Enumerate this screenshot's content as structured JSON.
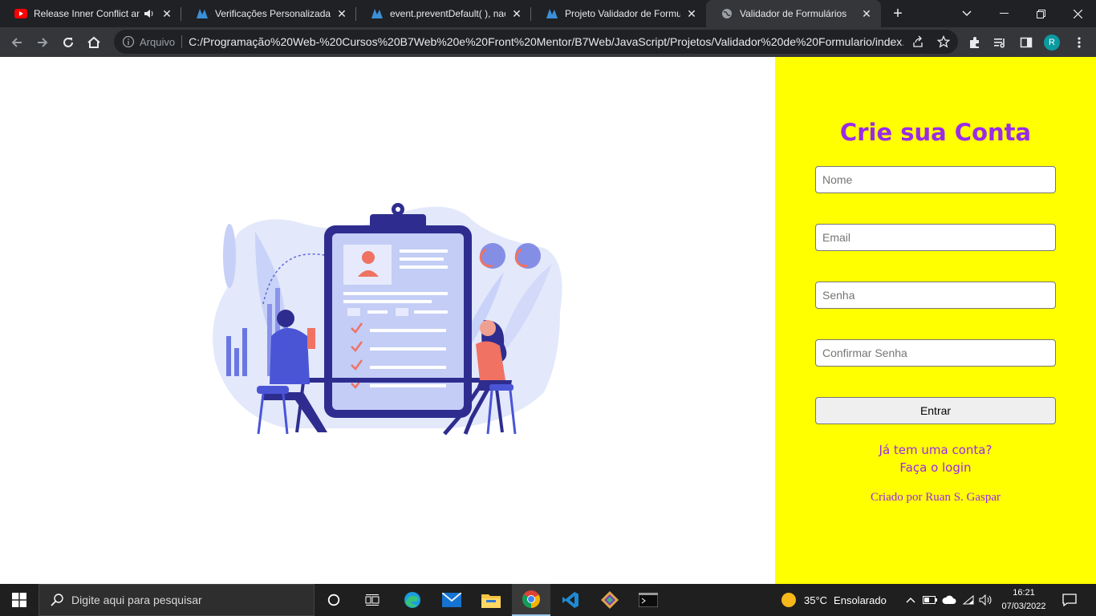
{
  "browser": {
    "tabs": [
      {
        "title": "Release Inner Conflict an",
        "favicon": "youtube-icon",
        "audio": true,
        "active": false
      },
      {
        "title": "Verificações Personalizadas |",
        "favicon": "b7web-icon",
        "active": false
      },
      {
        "title": "event.preventDefault( ), nao f",
        "favicon": "b7web-icon",
        "active": false
      },
      {
        "title": "Projeto Validador de Formulá",
        "favicon": "b7web-icon",
        "active": false
      },
      {
        "title": "Validador de Formulários",
        "favicon": "globe-icon",
        "active": true
      }
    ],
    "omnibox": {
      "security_label": "Arquivo",
      "url": "C:/Programação%20Web-%20Cursos%20B7Web%20e%20Front%20Mentor/B7Web/JavaScript/Projetos/Validador%20de%20Formulario/index..."
    },
    "profile_initial": "R"
  },
  "page": {
    "form": {
      "title": "Crie sua Conta",
      "fields": [
        {
          "placeholder": "Nome",
          "value": ""
        },
        {
          "placeholder": "Email",
          "value": ""
        },
        {
          "placeholder": "Senha",
          "value": ""
        },
        {
          "placeholder": "Confirmar Senha",
          "value": ""
        }
      ],
      "submit_label": "Entrar",
      "login_line1": "Já tem uma conta?",
      "login_line2": "Faça o login",
      "credit": "Criado por Ruan S. Gaspar"
    },
    "colors": {
      "panel_bg": "#ffff00",
      "accent": "#9a2be8"
    }
  },
  "taskbar": {
    "search_placeholder": "Digite aqui para pesquisar",
    "weather_temp": "35°C",
    "weather_desc": "Ensolarado",
    "time": "16:21",
    "date": "07/03/2022"
  }
}
